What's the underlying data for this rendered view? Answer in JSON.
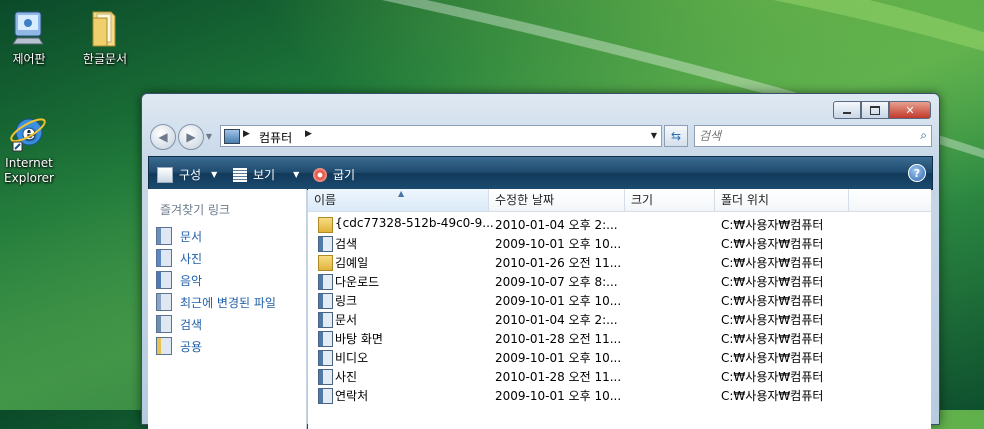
{
  "desktop": {
    "icons": [
      {
        "label": "제어판",
        "icon": "control-panel-icon"
      },
      {
        "label": "한글문서",
        "icon": "folder-icon"
      },
      {
        "label": "Internet Explorer",
        "icon": "internet-explorer-icon"
      }
    ]
  },
  "window": {
    "buttons": {
      "minimize": "minimize-icon",
      "maximize": "maximize-icon",
      "close": "close-icon"
    },
    "address": {
      "path": "컴퓨터"
    },
    "search": {
      "placeholder": "검색"
    },
    "toolbar": {
      "organize": "구성",
      "views": "보기",
      "burn": "굽기",
      "help": "?"
    },
    "nav": {
      "title": "즐겨찾기 링크",
      "items": [
        {
          "label": "문서",
          "icon": "documents-icon"
        },
        {
          "label": "사진",
          "icon": "pictures-icon"
        },
        {
          "label": "음악",
          "icon": "music-icon"
        },
        {
          "label": "최근에 변경된 파일",
          "icon": "recent-icon"
        },
        {
          "label": "검색",
          "icon": "searches-icon"
        },
        {
          "label": "공용",
          "icon": "public-folder-icon"
        }
      ]
    },
    "columns": [
      "이름",
      "수정한 날짜",
      "크기",
      "폴더 위치"
    ],
    "rows": [
      {
        "name": "{cdc77328-512b-49c0-9...",
        "date": "2010-01-04 오후 2:...",
        "size": "",
        "location": "C:₩사용자₩컴퓨터",
        "icon": "folder-icon"
      },
      {
        "name": "검색",
        "date": "2009-10-01 오후 10...",
        "size": "",
        "location": "C:₩사용자₩컴퓨터",
        "icon": "searches-icon"
      },
      {
        "name": "김예일",
        "date": "2010-01-26 오전 11...",
        "size": "",
        "location": "C:₩사용자₩컴퓨터",
        "icon": "folder-icon"
      },
      {
        "name": "다운로드",
        "date": "2009-10-07 오후 8:...",
        "size": "",
        "location": "C:₩사용자₩컴퓨터",
        "icon": "downloads-icon"
      },
      {
        "name": "링크",
        "date": "2009-10-01 오후 10...",
        "size": "",
        "location": "C:₩사용자₩컴퓨터",
        "icon": "links-icon"
      },
      {
        "name": "문서",
        "date": "2010-01-04 오후 2:...",
        "size": "",
        "location": "C:₩사용자₩컴퓨터",
        "icon": "documents-icon"
      },
      {
        "name": "바탕 화면",
        "date": "2010-01-28 오전 11...",
        "size": "",
        "location": "C:₩사용자₩컴퓨터",
        "icon": "desktop-folder-icon"
      },
      {
        "name": "비디오",
        "date": "2009-10-01 오후 10...",
        "size": "",
        "location": "C:₩사용자₩컴퓨터",
        "icon": "videos-icon"
      },
      {
        "name": "사진",
        "date": "2010-01-28 오전 11...",
        "size": "",
        "location": "C:₩사용자₩컴퓨터",
        "icon": "pictures-icon"
      },
      {
        "name": "연락처",
        "date": "2009-10-01 오후 10...",
        "size": "",
        "location": "C:₩사용자₩컴퓨터",
        "icon": "contacts-icon"
      }
    ]
  }
}
